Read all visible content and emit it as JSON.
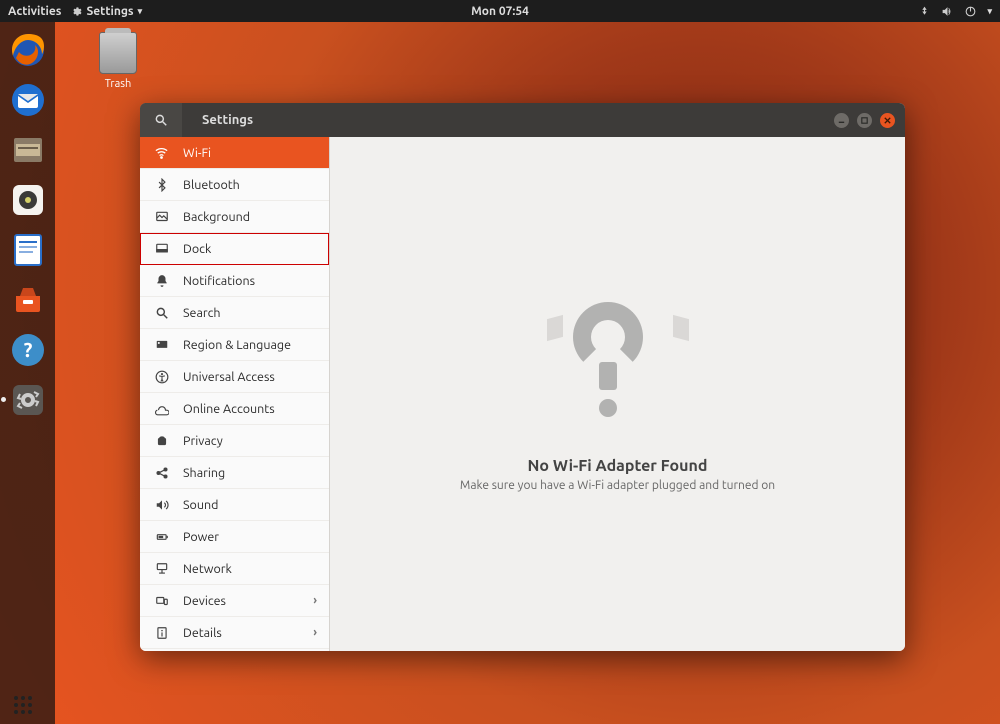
{
  "topbar": {
    "activities": "Activities",
    "app_menu": "Settings",
    "clock": "Mon 07:54"
  },
  "desktop": {
    "trash_label": "Trash"
  },
  "window": {
    "title": "Settings"
  },
  "sidebar": {
    "items": [
      {
        "id": "wifi",
        "label": "Wi-Fi",
        "icon": "wifi-icon",
        "active": true
      },
      {
        "id": "bluetooth",
        "label": "Bluetooth",
        "icon": "bluetooth-icon"
      },
      {
        "id": "background",
        "label": "Background",
        "icon": "background-icon"
      },
      {
        "id": "dock",
        "label": "Dock",
        "icon": "dock-icon",
        "highlighted": true
      },
      {
        "id": "notifications",
        "label": "Notifications",
        "icon": "notifications-icon"
      },
      {
        "id": "search",
        "label": "Search",
        "icon": "search-icon"
      },
      {
        "id": "region",
        "label": "Region & Language",
        "icon": "region-icon"
      },
      {
        "id": "universal",
        "label": "Universal Access",
        "icon": "universal-access-icon"
      },
      {
        "id": "online",
        "label": "Online Accounts",
        "icon": "online-accounts-icon"
      },
      {
        "id": "privacy",
        "label": "Privacy",
        "icon": "privacy-icon"
      },
      {
        "id": "sharing",
        "label": "Sharing",
        "icon": "sharing-icon"
      },
      {
        "id": "sound",
        "label": "Sound",
        "icon": "sound-icon"
      },
      {
        "id": "power",
        "label": "Power",
        "icon": "power-icon"
      },
      {
        "id": "network",
        "label": "Network",
        "icon": "network-icon"
      },
      {
        "id": "devices",
        "label": "Devices",
        "icon": "devices-icon",
        "submenu": true
      },
      {
        "id": "details",
        "label": "Details",
        "icon": "details-icon",
        "submenu": true
      }
    ]
  },
  "content": {
    "heading": "No Wi-Fi Adapter Found",
    "subtext": "Make sure you have a Wi-Fi adapter plugged and turned on"
  },
  "dock_items": [
    "firefox",
    "thunderbird",
    "files",
    "rhythmbox",
    "writer",
    "software",
    "help",
    "settings"
  ]
}
